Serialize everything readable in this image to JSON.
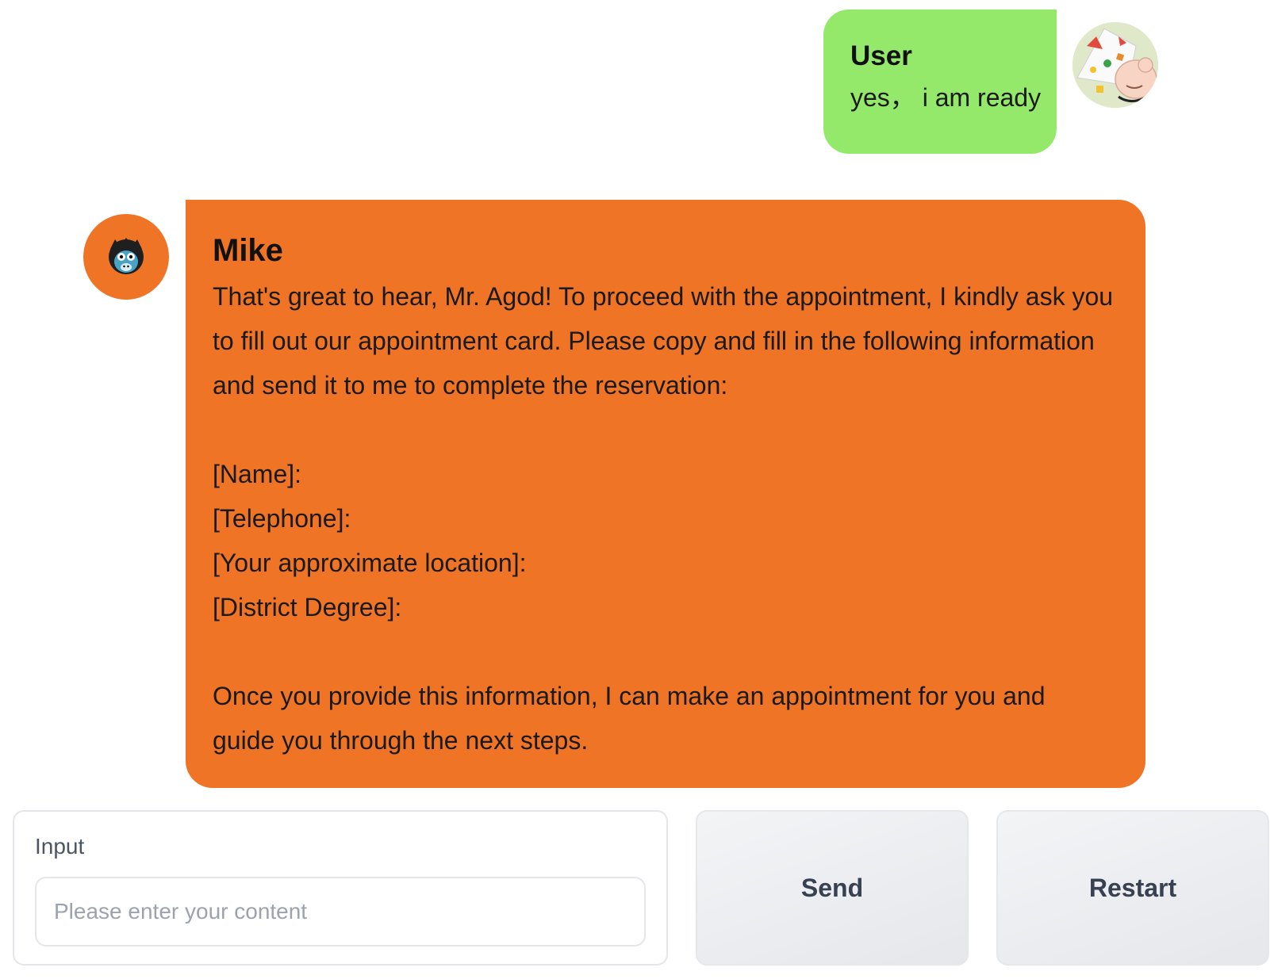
{
  "chat": {
    "user_message": {
      "sender": "User",
      "text": "yes， i am ready",
      "avatar_icon": "cartoon-user-avatar-icon"
    },
    "bot_message": {
      "sender": "Mike",
      "avatar_icon": "monkey-avatar-icon",
      "lines": [
        "That's great to hear, Mr. Agod! To proceed with the appointment, I kindly ask you to fill out our appointment card. Please copy and fill in the following information and send it to me to complete the reservation:",
        "[Name]:",
        "[Telephone]:",
        "[Your approximate location]:",
        "[District Degree]:",
        "Once you provide this information, I can make an appointment for you and guide you through the next steps."
      ]
    }
  },
  "input": {
    "label": "Input",
    "placeholder": "Please enter your content",
    "value": ""
  },
  "buttons": {
    "send": "Send",
    "restart": "Restart"
  },
  "colors": {
    "user_bubble": "#94e96a",
    "bot_bubble": "#f07426",
    "button_bg": "#eceef1"
  }
}
